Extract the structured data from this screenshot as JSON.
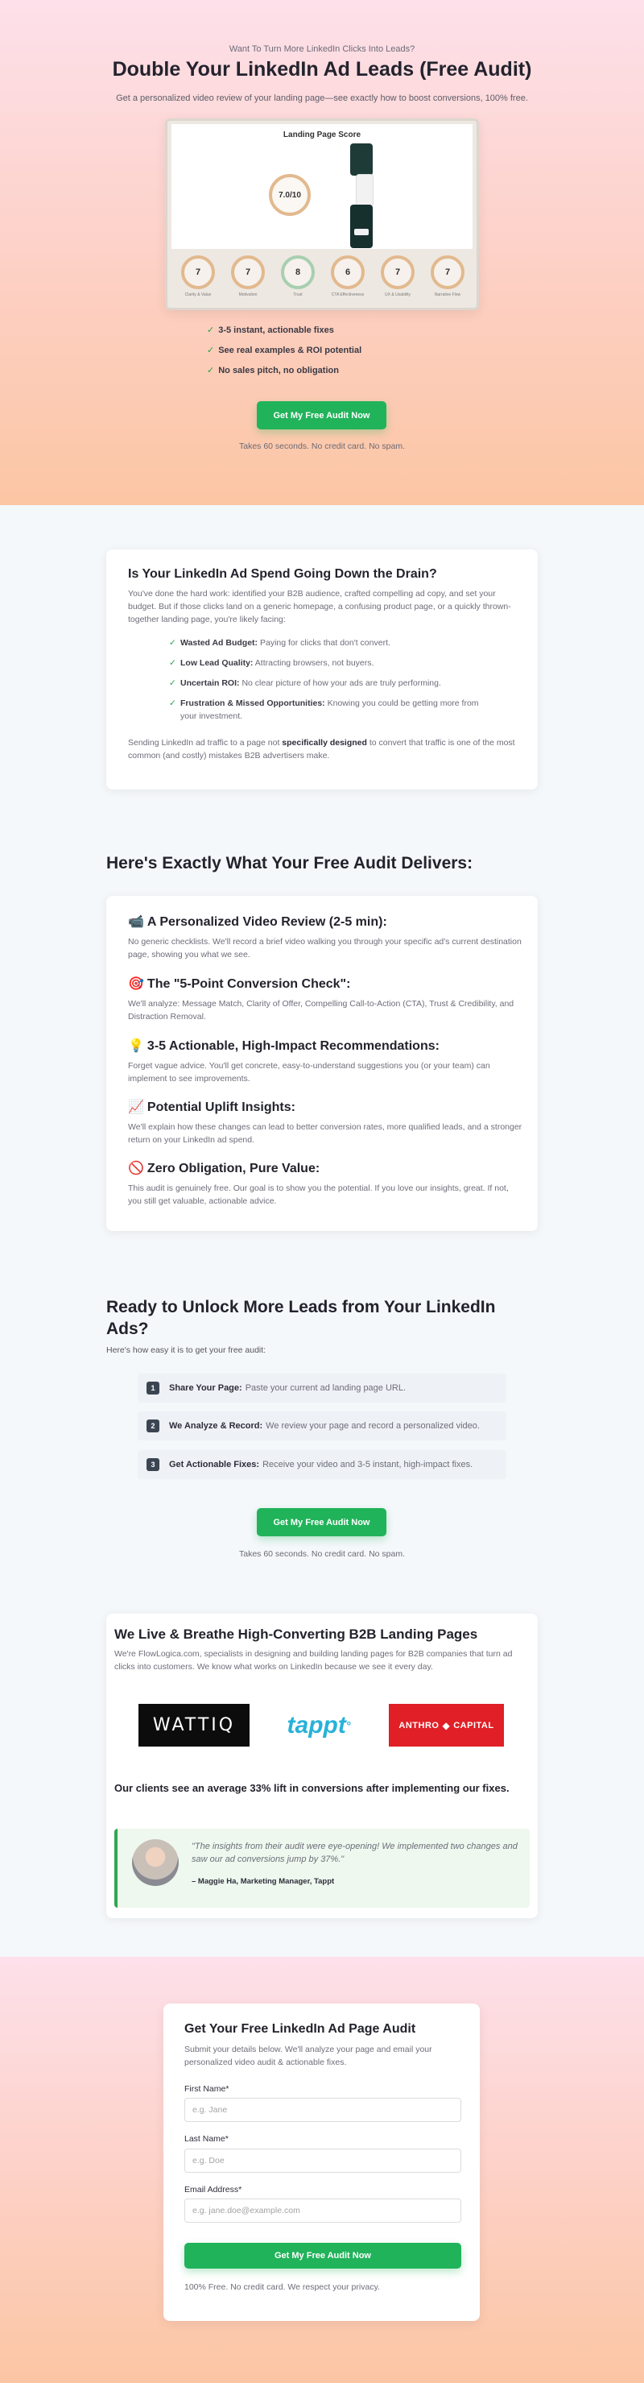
{
  "hero": {
    "eyebrow": "Want To Turn More LinkedIn Clicks Into Leads?",
    "title": "Double Your LinkedIn Ad Leads (Free Audit)",
    "subtitle": "Get a personalized video review of your landing page—see exactly how to boost conversions, 100% free.",
    "mockup": {
      "title": "Landing Page Score",
      "overall_score": "7.0/10",
      "scores": [
        {
          "value": "7",
          "label": "Clarity & Value"
        },
        {
          "value": "7",
          "label": "Motivation"
        },
        {
          "value": "8",
          "label": "Trust"
        },
        {
          "value": "6",
          "label": "CTA Effectiveness"
        },
        {
          "value": "7",
          "label": "UX & Usability"
        },
        {
          "value": "7",
          "label": "Narrative Flow"
        }
      ]
    },
    "checks": [
      "3-5 instant, actionable fixes",
      "See real examples & ROI potential",
      "No sales pitch, no obligation"
    ],
    "cta_label": "Get My Free Audit Now",
    "cta_note": "Takes 60 seconds. No credit card. No spam."
  },
  "drain": {
    "title": "Is Your LinkedIn Ad Spend Going Down the Drain?",
    "intro": "You've done the hard work: identified your B2B audience, crafted compelling ad copy, and set your budget. But if those clicks land on a generic homepage, a confusing product page, or a quickly thrown-together landing page, you're likely facing:",
    "items": [
      {
        "bold": "Wasted Ad Budget:",
        "text": "Paying for clicks that don't convert."
      },
      {
        "bold": "Low Lead Quality:",
        "text": "Attracting browsers, not buyers."
      },
      {
        "bold": "Uncertain ROI:",
        "text": "No clear picture of how your ads are truly performing."
      },
      {
        "bold": "Frustration & Missed Opportunities:",
        "text": "Knowing you could be getting more from your investment."
      }
    ],
    "outro_pre": "Sending LinkedIn ad traffic to a page not ",
    "outro_bold": "specifically designed",
    "outro_post": " to convert that traffic is one of the most common (and costly) mistakes B2B advertisers make."
  },
  "delivers": {
    "title": "Here's Exactly What Your Free Audit Delivers:",
    "items": [
      {
        "emoji": "📹",
        "title": "A Personalized Video Review (2-5 min):",
        "text": "No generic checklists. We'll record a brief video walking you through your specific ad's current destination page, showing you what we see."
      },
      {
        "emoji": "🎯",
        "title": "The \"5-Point Conversion Check\":",
        "text": "We'll analyze: Message Match, Clarity of Offer, Compelling Call-to-Action (CTA), Trust & Credibility, and Distraction Removal."
      },
      {
        "emoji": "💡",
        "title": "3-5 Actionable, High-Impact Recommendations:",
        "text": "Forget vague advice. You'll get concrete, easy-to-understand suggestions you (or your team) can implement to see improvements."
      },
      {
        "emoji": "📈",
        "title": "Potential Uplift Insights:",
        "text": "We'll explain how these changes can lead to better conversion rates, more qualified leads, and a stronger return on your LinkedIn ad spend."
      },
      {
        "emoji": "🚫",
        "title": "Zero Obligation, Pure Value:",
        "text": "This audit is genuinely free. Our goal is to show you the potential. If you love our insights, great. If not, you still get valuable, actionable advice."
      }
    ]
  },
  "ready": {
    "title": "Ready to Unlock More Leads from Your LinkedIn Ads?",
    "subtitle": "Here's how easy it is to get your free audit:",
    "steps": [
      {
        "num": "1",
        "bold": "Share Your Page:",
        "text": "Paste your current ad landing page URL."
      },
      {
        "num": "2",
        "bold": "We Analyze & Record:",
        "text": "We review your page and record a personalized video."
      },
      {
        "num": "3",
        "bold": "Get Actionable Fixes:",
        "text": "Receive your video and 3-5 instant, high-impact fixes."
      }
    ],
    "cta_label": "Get My Free Audit Now",
    "cta_note": "Takes 60 seconds. No credit card. No spam."
  },
  "live": {
    "title": "We Live & Breathe High-Converting B2B Landing Pages",
    "intro": "We're FlowLogica.com, specialists in designing and building landing pages for B2B companies that turn ad clicks into customers. We know what works on LinkedIn because we see it every day.",
    "logos": {
      "wattiq": "WATTIQ",
      "tappt": "tappt",
      "anthro_left": "ANTHRO",
      "anthro_right": "CAPITAL"
    },
    "stat": "Our clients see an average 33% lift in conversions after implementing our fixes.",
    "quote": "\"The insights from their audit were eye-opening! We implemented two changes and saw our ad conversions jump by 37%.\"",
    "quote_author": "– Maggie Ha, Marketing Manager, Tappt"
  },
  "form": {
    "title": "Get Your Free LinkedIn Ad Page Audit",
    "intro": "Submit your details below. We'll analyze your page and email your personalized video audit & actionable fixes.",
    "first_name_label": "First Name*",
    "first_name_placeholder": "e.g. Jane",
    "last_name_label": "Last Name*",
    "last_name_placeholder": "e.g. Doe",
    "email_label": "Email Address*",
    "email_placeholder": "e.g. jane.doe@example.com",
    "submit_label": "Get My Free Audit Now",
    "note": "100% Free. No credit card. We respect your privacy."
  },
  "colors": {
    "accent_green": "#21b35a",
    "check_green": "#22a14a",
    "score_ring": "#e2b98e",
    "trust_ring": "#a8cfb0",
    "tappt_blue": "#27b2d8",
    "anthro_red": "#e01f26"
  }
}
